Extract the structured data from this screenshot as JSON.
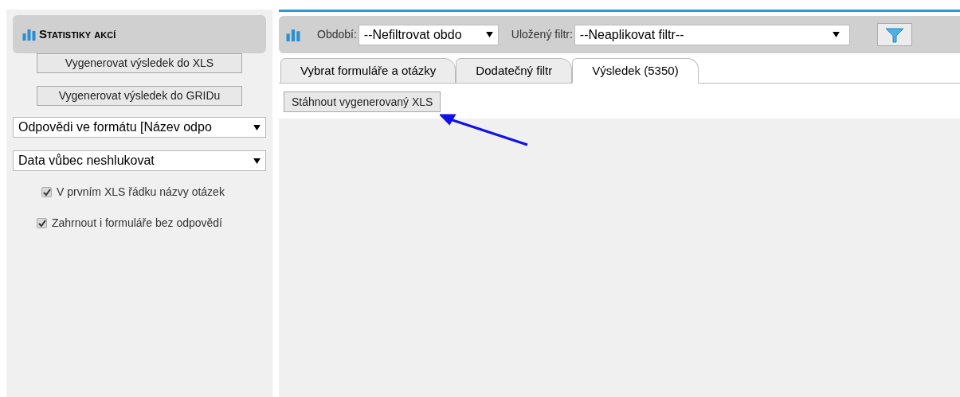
{
  "sidebar": {
    "title": "Statistiky akcí",
    "buttons": [
      "Vygenerovat výsledek do XLS",
      "Vygenerovat výsledek do GRIDu"
    ],
    "selects": [
      {
        "value": "Odpovědi ve formátu [Název odpo"
      },
      {
        "value": "Data vůbec neshlukovat"
      }
    ],
    "checkboxes": [
      {
        "label": "V prvním XLS řádku názvy otázek",
        "checked": true
      },
      {
        "label": "Zahrnout i formuláře bez odpovědí",
        "checked": true
      }
    ]
  },
  "toolbar": {
    "period_label": "Období:",
    "period_value": "--Nefiltrovat obdo",
    "saved_filter_label": "Uložený filtr:",
    "saved_filter_value": "--Neaplikovat filtr--"
  },
  "tabs": [
    {
      "label": "Vybrat formuláře a otázky",
      "selected": false
    },
    {
      "label": "Dodatečný filtr",
      "selected": false
    },
    {
      "label": "Výsledek (5350)",
      "selected": true
    }
  ],
  "content": {
    "button": "Stáhnout vygenerovaný XLS"
  }
}
